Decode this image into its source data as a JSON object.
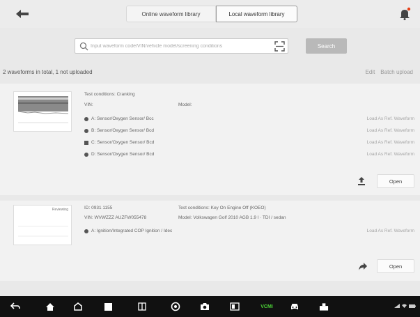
{
  "header": {
    "tabs": [
      {
        "label": "Online waveform library",
        "active": false
      },
      {
        "label": "Local waveform library",
        "active": true
      }
    ]
  },
  "search": {
    "placeholder": "Input waveform code/VIN/vehicle model/screening conditions",
    "button_label": "Search"
  },
  "summary": {
    "text": "2 waveforms in total, 1 not uploaded",
    "edit_label": "Edit",
    "batch_label": "Batch upload"
  },
  "waveforms": [
    {
      "thumb_label": "",
      "test_conditions": "Test conditions: Cranking",
      "vin": "VIN:",
      "model": "Model:",
      "channels": [
        {
          "name": "A: Sensor/Oxygen Sensor/ Bcc",
          "link": "Load As Ref. Waveform"
        },
        {
          "name": "B: Sensor/Oxygen Sensor/ Bcd",
          "link": "Load As Ref. Waveform"
        },
        {
          "name": "C: Sensor/Oxygen Sensor/ Bcd",
          "link": "Load As Ref. Waveform"
        },
        {
          "name": "D: Sensor/Oxygen Sensor/ Bcd",
          "link": "Load As Ref. Waveform"
        }
      ],
      "open_label": "Open"
    },
    {
      "thumb_label": "Reviewing",
      "id": "ID: 0931 1155",
      "vin": "VIN: WVWZZZ AUZFW055478",
      "test_conditions": "Test conditions: Key On Engine Off (KOEO)",
      "model": "Model: Volkswagen Golf 2010 AGB 1.9 l · TDI / sedan",
      "channels": [
        {
          "name": "A: Ignition/Integrated COP Ignition / Idec",
          "link": "Load As Ref. Waveform"
        }
      ],
      "open_label": "Open"
    }
  ],
  "navbar": {
    "icons": [
      "back-arrow-icon",
      "home-icon",
      "house-icon",
      "stop-icon",
      "recent-apps-icon",
      "browser-icon",
      "camera-icon",
      "screen-mirror-icon",
      "vcmi-icon",
      "car-icon",
      "diagnostics-icon"
    ],
    "vcmi_label": "VCMI"
  },
  "colors": {
    "accent": "#b9b9b9",
    "navbar": "#111111",
    "vcmi": "#4cd137"
  }
}
